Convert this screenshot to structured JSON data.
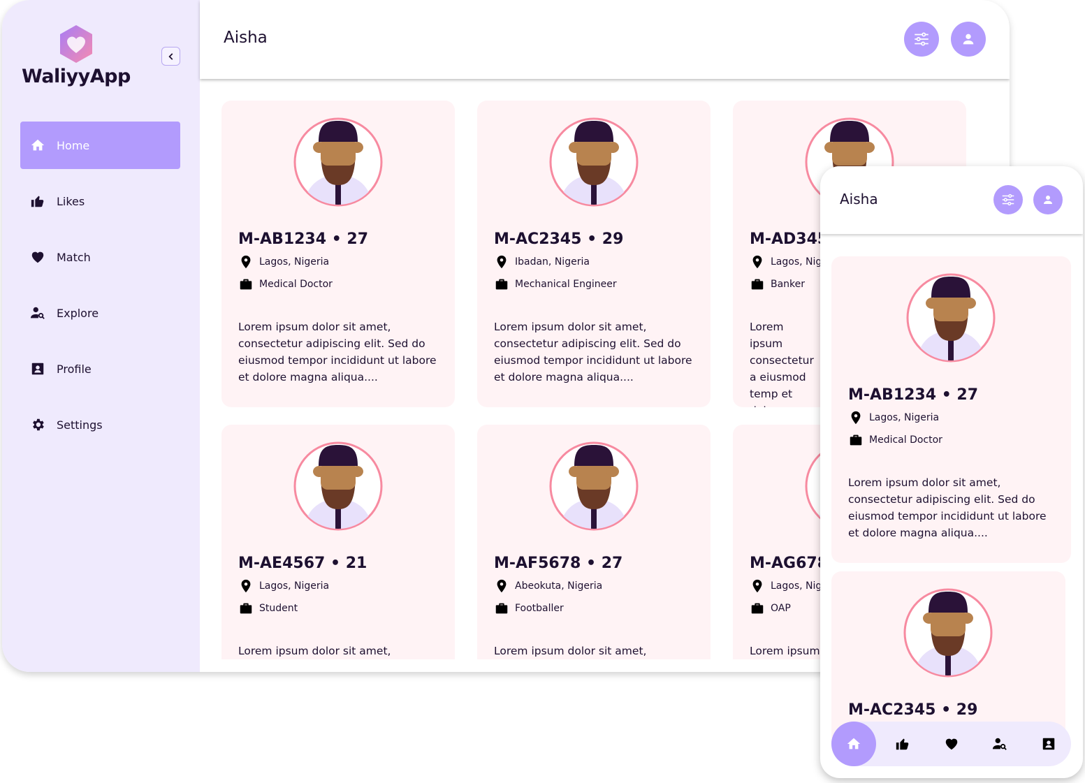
{
  "app": {
    "name": "WaliyyApp"
  },
  "sidebar": {
    "items": [
      {
        "label": "Home",
        "icon": "home-icon",
        "active": true
      },
      {
        "label": "Likes",
        "icon": "thumbs-up-icon",
        "active": false
      },
      {
        "label": "Match",
        "icon": "heart-icon",
        "active": false
      },
      {
        "label": "Explore",
        "icon": "user-search-icon",
        "active": false
      },
      {
        "label": "Profile",
        "icon": "profile-card-icon",
        "active": false
      },
      {
        "label": "Settings",
        "icon": "gear-icon",
        "active": false
      }
    ]
  },
  "header": {
    "title": "Aisha"
  },
  "profiles": [
    {
      "title": "M-AB1234 • 27",
      "location": "Lagos, Nigeria",
      "occupation": "Medical Doctor",
      "description": "Lorem ipsum dolor sit amet, consectetur adipiscing elit. Sed do eiusmod tempor incididunt ut labore et dolore magna aliqua...."
    },
    {
      "title": "M-AC2345 • 29",
      "location": "Ibadan, Nigeria",
      "occupation": "Mechanical Engineer",
      "description": "Lorem ipsum dolor sit amet, consectetur adipiscing elit. Sed do eiusmod tempor incididunt ut labore et dolore magna aliqua...."
    },
    {
      "title": "M-AD345",
      "location": "Lagos, Nig",
      "occupation": "Banker",
      "description": "Lorem ipsum consectetur a eiusmod temp et dolore mag"
    },
    {
      "title": "M-AE4567 • 21",
      "location": "Lagos, Nigeria",
      "occupation": "Student",
      "description": "Lorem ipsum dolor sit amet,"
    },
    {
      "title": "M-AF5678 • 27",
      "location": "Abeokuta, Nigeria",
      "occupation": "Footballer",
      "description": "Lorem ipsum dolor sit amet,"
    },
    {
      "title": "M-AG678",
      "location": "Lagos, Nig",
      "occupation": "OAP",
      "description": "Lorem ipsum"
    }
  ],
  "mobile": {
    "header": {
      "title": "Aisha"
    },
    "profiles": [
      {
        "title": "M-AB1234 • 27",
        "location": "Lagos, Nigeria",
        "occupation": "Medical Doctor",
        "description": "Lorem ipsum dolor sit amet, consectetur adipiscing elit. Sed do eiusmod tempor incididunt ut labore et dolore magna aliqua...."
      },
      {
        "title": "M-AC2345 • 29"
      }
    ],
    "bottom_nav": [
      "home-icon",
      "thumbs-up-icon",
      "heart-icon",
      "user-search-icon",
      "profile-card-icon"
    ]
  },
  "colors": {
    "accent": "#b29bfd",
    "sidebar_bg": "#efeafd",
    "card_bg": "#fff3f5",
    "avatar_ring": "#f78aa0",
    "text": "#1d1030"
  }
}
